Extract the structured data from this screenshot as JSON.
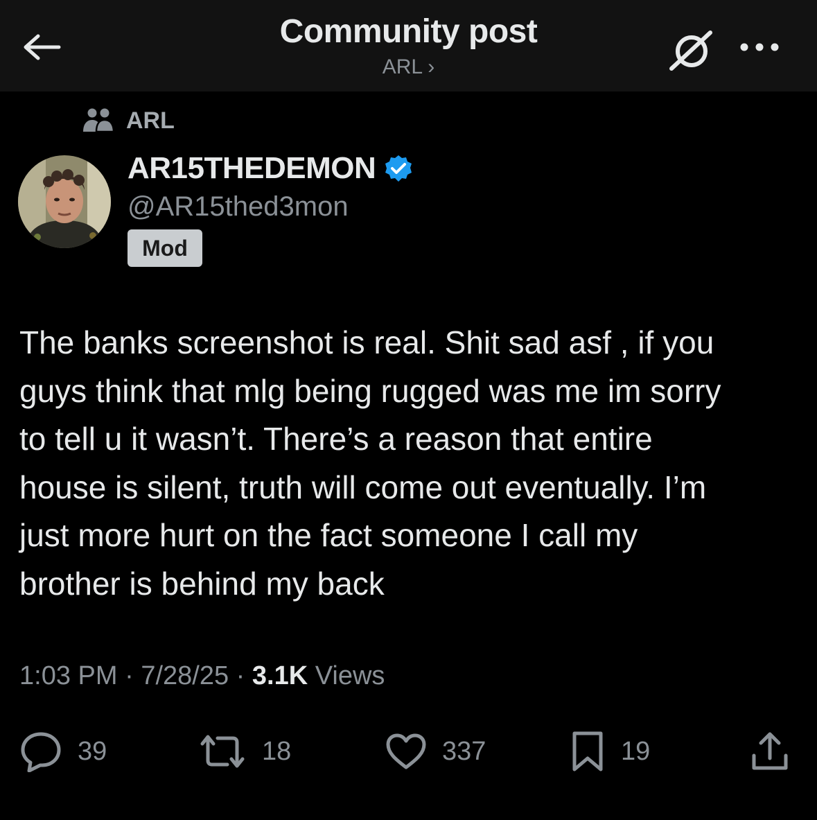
{
  "header": {
    "title": "Community post",
    "subtitle": "ARL ›"
  },
  "community": {
    "name": "ARL"
  },
  "author": {
    "display_name": "AR15THEDEMON",
    "handle": "@AR15thed3mon",
    "badge": "Mod",
    "verified_color": "#1d9bf0"
  },
  "post": {
    "text": "The banks screenshot is real. Shit sad asf , if you\nguys think that mlg being rugged was me im sorry\nto tell u it wasn’t. There’s a reason that entire\nhouse is silent, truth will come out eventually. I’m\njust more hurt on the fact someone I call my\nbrother is behind my back"
  },
  "meta": {
    "time": "1:03 PM",
    "sep1": " · ",
    "date": "7/28/25",
    "sep2": " · ",
    "views_count": "3.1K",
    "views_label": " Views"
  },
  "actions": {
    "replies": "39",
    "reposts": "18",
    "likes": "337",
    "bookmarks": "19"
  },
  "icons": {
    "back": "arrow-left",
    "grok": "grok-slash",
    "more": "ellipsis",
    "community": "people",
    "verified": "verified-badge",
    "reply": "speech-bubble",
    "repost": "repost-arrows",
    "like": "heart",
    "bookmark": "bookmark",
    "share": "share-upload"
  }
}
